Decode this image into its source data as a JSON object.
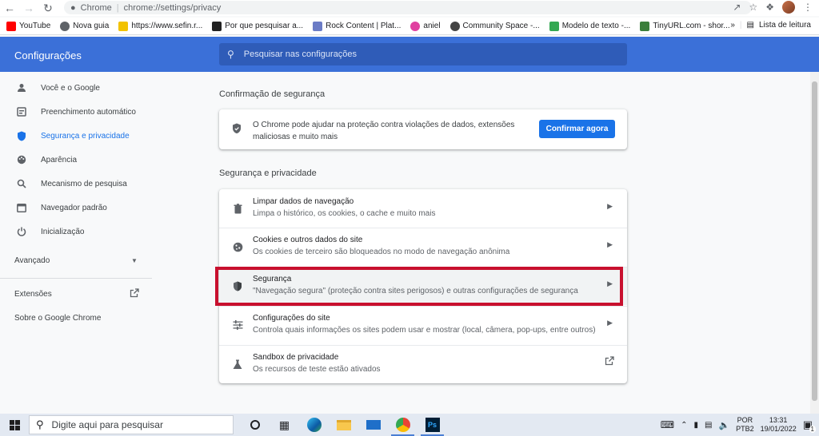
{
  "browser": {
    "app_name": "Chrome",
    "url": "chrome://settings/privacy"
  },
  "bookmarks": [
    {
      "label": "YouTube",
      "color": "#ff0000"
    },
    {
      "label": "Nova guia",
      "color": "#5f6368"
    },
    {
      "label": "https://www.sefin.r...",
      "color": "#f2c200"
    },
    {
      "label": "Por que pesquisar a...",
      "color": "#222222"
    },
    {
      "label": "Rock Content | Plat...",
      "color": "#6b7cc6"
    },
    {
      "label": "aniel",
      "color": "#e040a0"
    },
    {
      "label": "Community Space -...",
      "color": "#444444"
    },
    {
      "label": "Modelo de texto -...",
      "color": "#34a853"
    },
    {
      "label": "TinyURL.com - shor...",
      "color": "#3c7f3c"
    }
  ],
  "bookmarks_more": "»",
  "reading_list": "Lista de leitura",
  "settings": {
    "title": "Configurações",
    "search_placeholder": "Pesquisar nas configurações"
  },
  "sidebar": {
    "items": [
      {
        "label": "Você e o Google",
        "icon": "person-icon"
      },
      {
        "label": "Preenchimento automático",
        "icon": "autofill-icon"
      },
      {
        "label": "Segurança e privacidade",
        "icon": "shield-icon",
        "active": true
      },
      {
        "label": "Aparência",
        "icon": "palette-icon"
      },
      {
        "label": "Mecanismo de pesquisa",
        "icon": "search-icon"
      },
      {
        "label": "Navegador padrão",
        "icon": "browser-icon"
      },
      {
        "label": "Inicialização",
        "icon": "power-icon"
      }
    ],
    "advanced": "Avançado",
    "extensions": "Extensões",
    "about": "Sobre o Google Chrome"
  },
  "safety_check": {
    "heading": "Confirmação de segurança",
    "text": "O Chrome pode ajudar na proteção contra violações de dados, extensões maliciosas e muito mais",
    "button": "Confirmar agora"
  },
  "privacy": {
    "heading": "Segurança e privacidade",
    "rows": [
      {
        "title": "Limpar dados de navegação",
        "desc": "Limpa o histórico, os cookies, o cache e muito mais"
      },
      {
        "title": "Cookies e outros dados do site",
        "desc": "Os cookies de terceiro são bloqueados no modo de navegação anônima"
      },
      {
        "title": "Segurança",
        "desc": "\"Navegação segura\" (proteção contra sites perigosos) e outras configurações de segurança"
      },
      {
        "title": "Configurações do site",
        "desc": "Controla quais informações os sites podem usar e mostrar (local, câmera, pop-ups, entre outros)"
      },
      {
        "title": "Sandbox de privacidade",
        "desc": "Os recursos de teste estão ativados"
      }
    ]
  },
  "colors": {
    "header": "#3b70d8",
    "accent": "#1a73e8",
    "highlight": "#c8102e"
  },
  "taskbar": {
    "search_placeholder": "Digite aqui para pesquisar",
    "lang_top": "POR",
    "lang_bottom": "PTB2",
    "time": "13:31",
    "date": "19/01/2022",
    "notifications": "1"
  }
}
